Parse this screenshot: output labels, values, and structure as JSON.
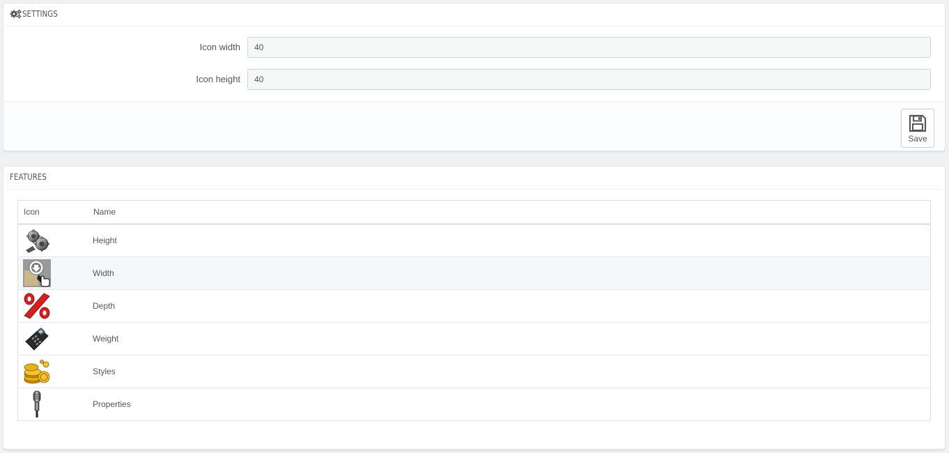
{
  "settings": {
    "heading": "SETTINGS",
    "heading_icon": "cogs-icon",
    "icon_width": {
      "label": "Icon width",
      "value": "40"
    },
    "icon_height": {
      "label": "Icon height",
      "value": "40"
    },
    "save_label": "Save"
  },
  "features": {
    "heading": "FEATURES",
    "columns": {
      "icon": "Icon",
      "name": "Name"
    },
    "rows": [
      {
        "name": "Height",
        "icon": "gears-icon"
      },
      {
        "name": "Width",
        "icon": "download-hand-icon"
      },
      {
        "name": "Depth",
        "icon": "percent-icon"
      },
      {
        "name": "Weight",
        "icon": "card-terminal-icon"
      },
      {
        "name": "Styles",
        "icon": "coins-icon"
      },
      {
        "name": "Properties",
        "icon": "microphone-icon"
      }
    ]
  },
  "colors": {
    "page_bg": "#eff1f2",
    "input_bg": "#f5f8f9",
    "header_border": "#a0d0eb",
    "percent_red": "#d42020",
    "coin_gold": "#e8b010"
  }
}
